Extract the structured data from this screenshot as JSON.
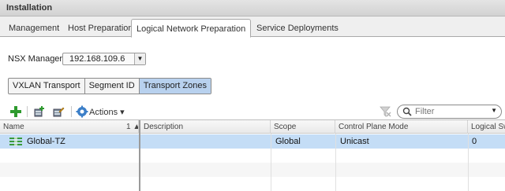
{
  "title": "Installation",
  "tabs": [
    {
      "label": "Management"
    },
    {
      "label": "Host Preparation"
    },
    {
      "label": "Logical Network Preparation",
      "active": true
    },
    {
      "label": "Service Deployments"
    }
  ],
  "nsx_manager": {
    "label": "NSX Manager:",
    "value": "192.168.109.6"
  },
  "subtabs": [
    {
      "label": "VXLAN Transport"
    },
    {
      "label": "Segment ID"
    },
    {
      "label": "Transport Zones",
      "active": true
    }
  ],
  "toolbar": {
    "icons": [
      "add-icon",
      "add-host-icon",
      "edit-icon",
      "gear-icon"
    ],
    "actions_label": "Actions",
    "filter_placeholder": "Filter"
  },
  "table": {
    "columns": [
      "Name",
      "Description",
      "Scope",
      "Control Plane Mode",
      "Logical Swi"
    ],
    "sort_indicator": "1 ▲",
    "rows": [
      {
        "name": "Global-TZ",
        "description": "",
        "scope": "Global",
        "control_plane_mode": "Unicast",
        "logical_switches": "0"
      }
    ]
  },
  "colors": {
    "selection": "#c4ddf6",
    "active_subtab": "#b8d1ee",
    "add_green": "#2e9a2e"
  }
}
